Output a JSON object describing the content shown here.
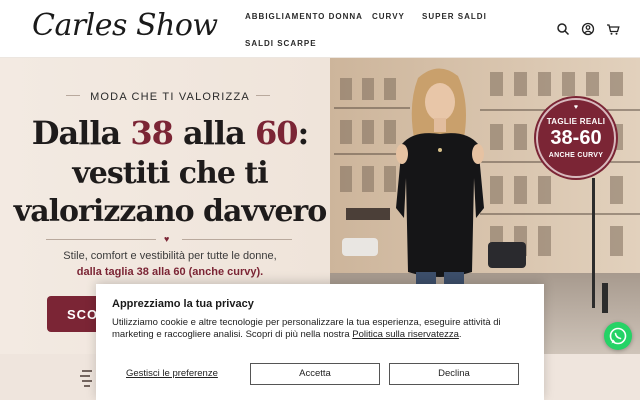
{
  "header": {
    "logo": "Carles Show",
    "nav": [
      {
        "label": "ABBIGLIAMENTO DONNA"
      },
      {
        "label": "CURVY"
      },
      {
        "label": "SUPER SALDI"
      },
      {
        "label": "SALDI SCARPE"
      }
    ],
    "icons": [
      "search-icon",
      "account-icon",
      "cart-icon"
    ]
  },
  "hero": {
    "kicker": "MODA CHE TI VALORIZZA",
    "headline": {
      "l1_a": "Dalla ",
      "l1_b": "38",
      "l1_c": " alla ",
      "l1_d": "60",
      "l1_e": ":",
      "l2": "vestiti che ti",
      "l3": "valorizzano davvero"
    },
    "sub1": "Stile, comfort e vestibilità per tutte le donne,",
    "sub2": "dalla taglia 38 alla 60 (anche curvy).",
    "cta_label": "SCOPRI LA COLLEZIONE",
    "badge": {
      "line1": "TAGLIE REALI",
      "line2": "38-60",
      "line3": "ANCHE CURVY"
    }
  },
  "cookie": {
    "title": "Apprezziamo la tua privacy",
    "text": "Utilizziamo cookie e altre tecnologie per personalizzare la tua esperienza, eseguire attività di marketing e raccogliere analisi. Scopri di più nella nostra ",
    "policy_link": "Politica sulla riservatezza",
    "text_end": ".",
    "preferences": "Gestisci le preferenze",
    "accept": "Accetta",
    "decline": "Declina"
  },
  "colors": {
    "accent": "#7b2535",
    "whatsapp": "#25d366"
  }
}
